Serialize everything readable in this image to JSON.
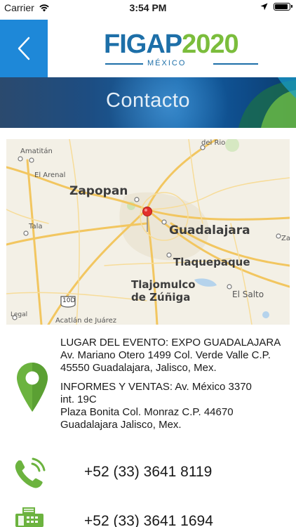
{
  "status_bar": {
    "carrier": "Carrier",
    "time": "3:54 PM",
    "battery_level": 0.9
  },
  "header": {
    "back_icon": "chevron-left-icon",
    "logo": {
      "text_main": "FIGAP",
      "text_year": "2020",
      "text_sub": "MÉXICO"
    },
    "accent_color": "#1e88d8"
  },
  "banner": {
    "title": "Contacto"
  },
  "map": {
    "pin_icon": "map-pin-icon",
    "labels": {
      "amatitan": "Amatitán",
      "del_rio": "del Rio",
      "el_arenal": "El Arenal",
      "zapopan": "Zapopan",
      "tala": "Tala",
      "guadalajara": "Guadalajara",
      "tlaquepaque": "Tlaquepaque",
      "tlajomulco_1": "Tlajomulco",
      "tlajomulco_2": "de Zúñiga",
      "el_salto": "El Salto",
      "route": "10D",
      "acatlan": "Acatlán de Juárez",
      "legal": "Legal",
      "za": "Za"
    }
  },
  "contact": {
    "location_icon": "location-pin-icon",
    "venue": {
      "line1": "LUGAR DEL EVENTO: EXPO GUADALAJARA",
      "line2": "Av. Mariano Otero 1499 Col. Verde Valle C.P.",
      "line3": "45550 Guadalajara, Jalisco, Mex."
    },
    "sales": {
      "line1": "INFORMES Y VENTAS: Av. México 3370",
      "line2": "int. 19C",
      "line3": "Plaza Bonita Col. Monraz C.P. 44670",
      "line4": "Guadalajara Jalisco, Mex."
    },
    "phone": {
      "icon": "phone-icon",
      "number": "+52 (33) 3641 8119"
    },
    "fax": {
      "icon": "fax-icon",
      "number": "+52 (33) 3641 1694"
    },
    "icon_color": "#6cb33f"
  }
}
